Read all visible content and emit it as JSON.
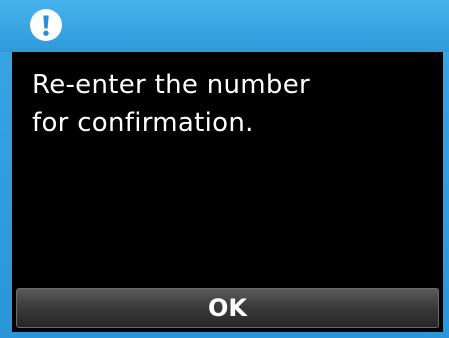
{
  "dialog": {
    "icon": "exclamation-circle-icon",
    "message": "Re-enter the number\nfor confirmation.",
    "ok_label": "OK"
  },
  "colors": {
    "title_bar": "#2e9ad9",
    "panel_background": "#000000",
    "text": "#ffffff",
    "button_background": "#3c3c3c"
  }
}
